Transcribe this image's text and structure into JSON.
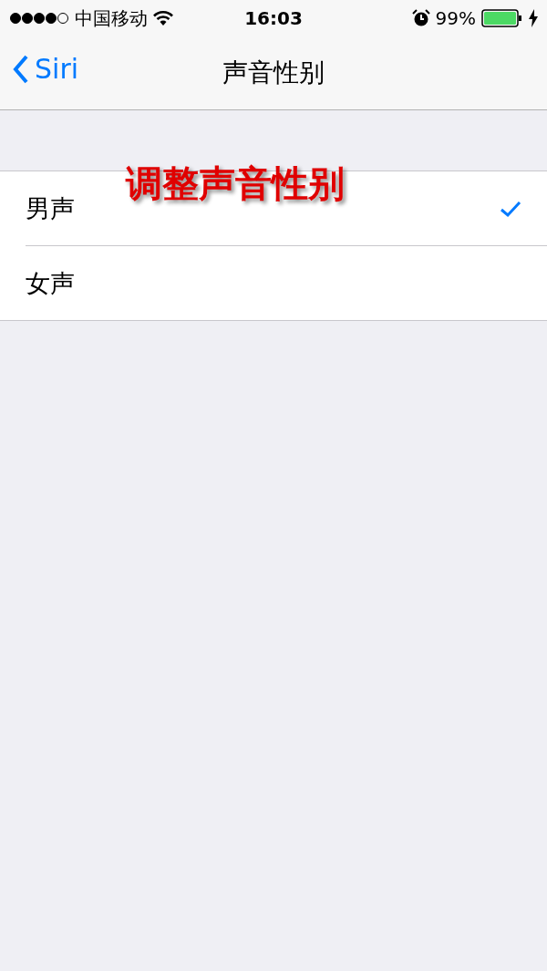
{
  "status_bar": {
    "carrier": "中国移动",
    "time": "16:03",
    "battery": "99%"
  },
  "nav": {
    "back": "Siri",
    "title": "声音性别"
  },
  "options": [
    {
      "label": "男声",
      "selected": true
    },
    {
      "label": "女声",
      "selected": false
    }
  ],
  "annotation": "调整声音性别"
}
